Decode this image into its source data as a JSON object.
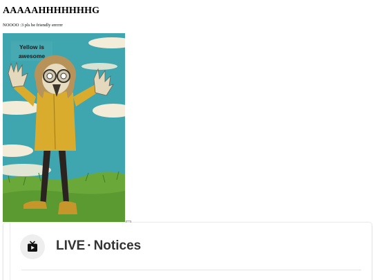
{
  "page": {
    "heading": "AAAAAHHHHHHHG",
    "subtext": "NOOOO :3 pls be friendly errrrrr"
  },
  "artwork": {
    "caption": "Yellow is awesome",
    "alt": "Cartoon figure in a yellow coat with arms raised, standing in grass under a blue sky",
    "palette": {
      "sky": "#3fa6b0",
      "cloud": "#f2ecd8",
      "coat": "#d9ac2e",
      "grass": "#6aa83a",
      "hair": "#b7935a"
    }
  },
  "notices_card": {
    "icon": "live-tv-icon",
    "live_label": "LIVE",
    "separator": "·",
    "section_label": "Notices"
  }
}
